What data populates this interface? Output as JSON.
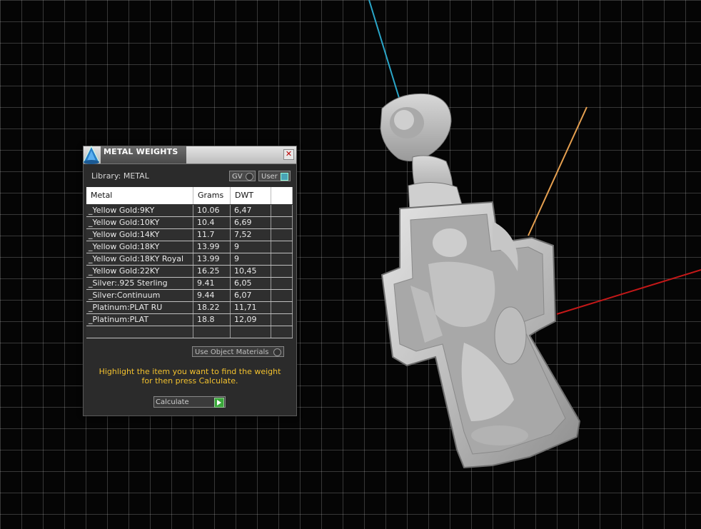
{
  "dialog": {
    "title": "METAL WEIGHTS",
    "library_label": "Library: METAL",
    "toggle_gv": "GV",
    "toggle_user": "User",
    "columns": [
      "Metal",
      "Grams",
      "DWT"
    ],
    "rows": [
      {
        "metal": "_Yellow Gold:9KY",
        "grams": "10.06",
        "dwt": "6,47"
      },
      {
        "metal": "_Yellow Gold:10KY",
        "grams": "10.4",
        "dwt": "6,69"
      },
      {
        "metal": "_Yellow Gold:14KY",
        "grams": "11.7",
        "dwt": "7,52"
      },
      {
        "metal": "_Yellow Gold:18KY",
        "grams": "13.99",
        "dwt": "9"
      },
      {
        "metal": "_Yellow Gold:18KY Royal",
        "grams": "13.99",
        "dwt": "9"
      },
      {
        "metal": "_Yellow Gold:22KY",
        "grams": "16.25",
        "dwt": "10,45"
      },
      {
        "metal": "_Silver:.925 Sterling",
        "grams": "9.41",
        "dwt": "6,05"
      },
      {
        "metal": "_Silver:Continuum",
        "grams": "9.44",
        "dwt": "6,07"
      },
      {
        "metal": "_Platinum:PLAT RU",
        "grams": "18.22",
        "dwt": "11,71"
      },
      {
        "metal": "_Platinum:PLAT",
        "grams": "18.8",
        "dwt": "12,09"
      },
      {
        "metal": "",
        "grams": "",
        "dwt": ""
      }
    ],
    "use_object_materials": "Use Object Materials",
    "instructions_line1": "Highlight the item you want to find the weight",
    "instructions_line2": "for then press Calculate.",
    "calculate_label": "Calculate",
    "close_glyph": "✕"
  },
  "colors": {
    "accent_instructions": "#f2c12e",
    "axis_x": "#d42020",
    "axis_y": "#e6a050",
    "axis_z": "#2aa6c8",
    "grid": "#ffffff"
  }
}
